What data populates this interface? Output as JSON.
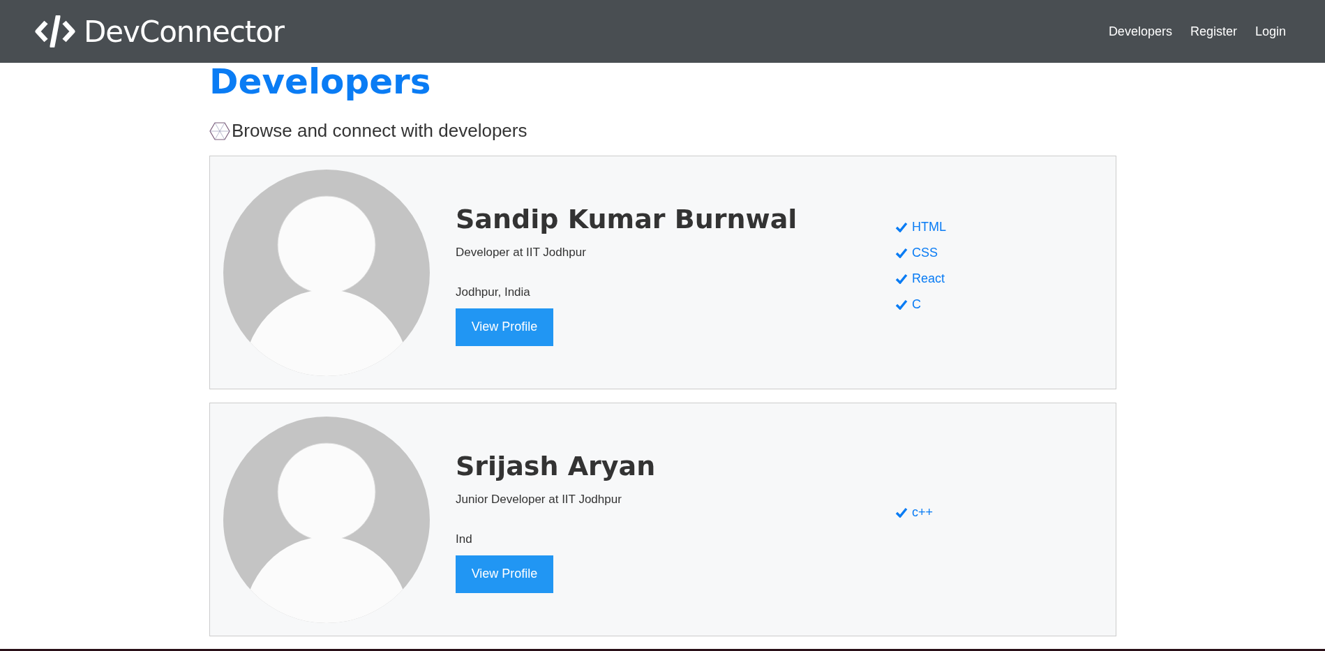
{
  "navbar": {
    "brand": "DevConnector",
    "links": [
      "Developers",
      "Register",
      "Login"
    ]
  },
  "heading": "Developers",
  "lead": "Browse and connect with developers",
  "profiles": [
    {
      "name": "Sandip Kumar Burnwal",
      "status": "Developer at IIT Jodhpur",
      "location": "Jodhpur, India",
      "button": "View Profile",
      "skills": [
        "HTML",
        "CSS",
        "React",
        "C"
      ]
    },
    {
      "name": "Srijash Aryan",
      "status": "Junior Developer at IIT Jodhpur",
      "location": "Ind",
      "button": "View Profile",
      "skills": [
        "c++"
      ]
    }
  ]
}
